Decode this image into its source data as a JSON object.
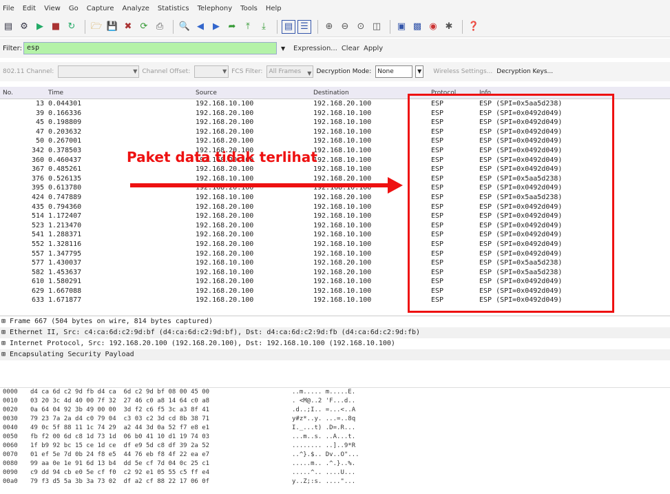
{
  "menu": [
    "File",
    "Edit",
    "View",
    "Go",
    "Capture",
    "Analyze",
    "Statistics",
    "Telephony",
    "Tools",
    "Help"
  ],
  "toolbar_icons": [
    "interface-icon",
    "options-icon",
    "start-icon",
    "stop-icon",
    "restart-icon",
    "open-icon",
    "save-icon",
    "close-icon",
    "reload-icon",
    "print-icon",
    "find-icon",
    "back-icon",
    "forward-icon",
    "goto-icon",
    "top-icon",
    "bottom-icon",
    "colorize-icon",
    "autoscroll-icon",
    "zoom-in-icon",
    "zoom-out-icon",
    "zoom-normal-icon",
    "resize-columns-icon",
    "capture-filters-icon",
    "display-filters-icon",
    "coloring-rules-icon",
    "preferences-icon",
    "help-icon"
  ],
  "filter": {
    "label": "Filter:",
    "value": "esp",
    "expression": "Expression...",
    "clear": "Clear",
    "apply": "Apply"
  },
  "wireless": {
    "channel_label": "802.11 Channel:",
    "offset_label": "Channel Offset:",
    "fcs_label": "FCS Filter:",
    "fcs_value": "All Frames",
    "decrypt_label": "Decryption Mode:",
    "decrypt_value": "None",
    "settings": "Wireless Settings...",
    "keys": "Decryption Keys..."
  },
  "columns": {
    "no": "No.",
    "time": "Time",
    "source": "Source",
    "destination": "Destination",
    "protocol": "Protocol",
    "info": "Info"
  },
  "packets": [
    {
      "no": "13",
      "time": "0.044301",
      "src": "192.168.10.100",
      "dst": "192.168.20.100",
      "proto": "ESP",
      "info": "ESP (SPI=0x5aa5d238)"
    },
    {
      "no": "39",
      "time": "0.166336",
      "src": "192.168.20.100",
      "dst": "192.168.10.100",
      "proto": "ESP",
      "info": "ESP (SPI=0x0492d049)"
    },
    {
      "no": "45",
      "time": "0.198809",
      "src": "192.168.20.100",
      "dst": "192.168.10.100",
      "proto": "ESP",
      "info": "ESP (SPI=0x0492d049)"
    },
    {
      "no": "47",
      "time": "0.203632",
      "src": "192.168.20.100",
      "dst": "192.168.10.100",
      "proto": "ESP",
      "info": "ESP (SPI=0x0492d049)"
    },
    {
      "no": "50",
      "time": "0.267001",
      "src": "192.168.20.100",
      "dst": "192.168.10.100",
      "proto": "ESP",
      "info": "ESP (SPI=0x0492d049)"
    },
    {
      "no": "342",
      "time": "0.378503",
      "src": "192.168.20.100",
      "dst": "192.168.10.100",
      "proto": "ESP",
      "info": "ESP (SPI=0x0492d049)"
    },
    {
      "no": "360",
      "time": "0.460437",
      "src": "192.168.20.100",
      "dst": "192.168.10.100",
      "proto": "ESP",
      "info": "ESP (SPI=0x0492d049)"
    },
    {
      "no": "367",
      "time": "0.485261",
      "src": "192.168.20.100",
      "dst": "192.168.10.100",
      "proto": "ESP",
      "info": "ESP (SPI=0x0492d049)"
    },
    {
      "no": "376",
      "time": "0.526135",
      "src": "192.168.10.100",
      "dst": "192.168.20.100",
      "proto": "ESP",
      "info": "ESP (SPI=0x5aa5d238)"
    },
    {
      "no": "395",
      "time": "0.613780",
      "src": "192.168.20.100",
      "dst": "192.168.10.100",
      "proto": "ESP",
      "info": "ESP (SPI=0x0492d049)"
    },
    {
      "no": "424",
      "time": "0.747889",
      "src": "192.168.10.100",
      "dst": "192.168.20.100",
      "proto": "ESP",
      "info": "ESP (SPI=0x5aa5d238)"
    },
    {
      "no": "435",
      "time": "0.794360",
      "src": "192.168.20.100",
      "dst": "192.168.10.100",
      "proto": "ESP",
      "info": "ESP (SPI=0x0492d049)"
    },
    {
      "no": "514",
      "time": "1.172407",
      "src": "192.168.20.100",
      "dst": "192.168.10.100",
      "proto": "ESP",
      "info": "ESP (SPI=0x0492d049)"
    },
    {
      "no": "523",
      "time": "1.213470",
      "src": "192.168.20.100",
      "dst": "192.168.10.100",
      "proto": "ESP",
      "info": "ESP (SPI=0x0492d049)"
    },
    {
      "no": "541",
      "time": "1.288371",
      "src": "192.168.20.100",
      "dst": "192.168.10.100",
      "proto": "ESP",
      "info": "ESP (SPI=0x0492d049)"
    },
    {
      "no": "552",
      "time": "1.328116",
      "src": "192.168.20.100",
      "dst": "192.168.10.100",
      "proto": "ESP",
      "info": "ESP (SPI=0x0492d049)"
    },
    {
      "no": "557",
      "time": "1.347795",
      "src": "192.168.20.100",
      "dst": "192.168.10.100",
      "proto": "ESP",
      "info": "ESP (SPI=0x0492d049)"
    },
    {
      "no": "577",
      "time": "1.430037",
      "src": "192.168.10.100",
      "dst": "192.168.20.100",
      "proto": "ESP",
      "info": "ESP (SPI=0x5aa5d238)"
    },
    {
      "no": "582",
      "time": "1.453637",
      "src": "192.168.10.100",
      "dst": "192.168.20.100",
      "proto": "ESP",
      "info": "ESP (SPI=0x5aa5d238)"
    },
    {
      "no": "610",
      "time": "1.580291",
      "src": "192.168.20.100",
      "dst": "192.168.10.100",
      "proto": "ESP",
      "info": "ESP (SPI=0x0492d049)"
    },
    {
      "no": "629",
      "time": "1.667088",
      "src": "192.168.20.100",
      "dst": "192.168.10.100",
      "proto": "ESP",
      "info": "ESP (SPI=0x0492d049)"
    },
    {
      "no": "633",
      "time": "1.671877",
      "src": "192.168.20.100",
      "dst": "192.168.10.100",
      "proto": "ESP",
      "info": "ESP (SPI=0x0492d049)"
    }
  ],
  "details": [
    "⊞ Frame 667 (504 bytes on wire, 814 bytes captured)",
    "⊞ Ethernet II, Src: c4:ca:6d:c2:9d:bf (d4:ca:6d:c2:9d:bf), Dst: d4:ca:6d:c2:9d:fb (d4:ca:6d:c2:9d:fb)",
    "⊞ Internet Protocol, Src: 192.168.20.100 (192.168.20.100), Dst: 192.168.10.100 (192.168.10.100)",
    "⊞ Encapsulating Security Payload"
  ],
  "hex": [
    {
      "off": "0000",
      "bytes": "d4 ca 6d c2 9d fb d4 ca  6d c2 9d bf 08 00 45 00",
      "ascii": "..m..... m.....E."
    },
    {
      "off": "0010",
      "bytes": "03 20 3c 4d 40 00 7f 32  27 46 c0 a8 14 64 c0 a8",
      "ascii": ". <M@..2 'F...d.."
    },
    {
      "off": "0020",
      "bytes": "0a 64 04 92 3b 49 00 00  3d f2 c6 f5 3c a3 8f 41",
      "ascii": ".d..;I.. =...<..A"
    },
    {
      "off": "0030",
      "bytes": "79 23 7a 2a d4 c0 79 04  c3 03 c2 3d cd 8b 38 71",
      "ascii": "y#z*..y. ...=..8q"
    },
    {
      "off": "0040",
      "bytes": "49 0c 5f 88 11 1c 74 29  a2 44 3d 0a 52 f7 e8 e1",
      "ascii": "I._...t) .D=.R..."
    },
    {
      "off": "0050",
      "bytes": "fb f2 00 6d c8 1d 73 1d  06 b0 41 10 d1 19 74 03",
      "ascii": "...m..s. ..A...t."
    },
    {
      "off": "0060",
      "bytes": "1f b9 92 bc 15 ce 1d ce  df e9 5d c8 df 39 2a 52",
      "ascii": "........ ..]..9*R"
    },
    {
      "off": "0070",
      "bytes": "01 ef 5e 7d 0b 24 f8 e5  44 76 eb f8 4f 22 ea e7",
      "ascii": "..^}.$.. Dv..O\"..."
    },
    {
      "off": "0080",
      "bytes": "99 aa 0e 1e 91 6d 13 b4  dd 5e cf 7d 04 0c 25 c1",
      "ascii": ".....m.. .^.}..%."
    },
    {
      "off": "0090",
      "bytes": "c9 dd 94 cb e0 5e cf f0  c2 92 e1 05 55 c5 ff e4",
      "ascii": ".....^.. ....U..."
    },
    {
      "off": "00a0",
      "bytes": "79 f3 d5 5a 3b 3a 73 02  df a2 cf 88 22 17 06 0f",
      "ascii": "y..Z;:s. ....\"..."
    }
  ],
  "annotation": "Paket data tidak terlihat"
}
